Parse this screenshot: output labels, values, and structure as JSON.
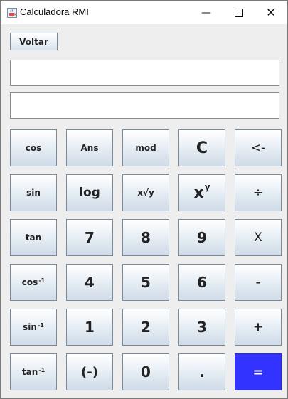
{
  "window": {
    "title": "Calculadora RMI",
    "minimize_glyph": "—",
    "close_glyph": "✕"
  },
  "toolbar": {
    "back_label": "Voltar"
  },
  "display": {
    "expression_value": "",
    "result_value": ""
  },
  "keys": [
    {
      "label": "cos"
    },
    {
      "label": "Ans"
    },
    {
      "label": "mod"
    },
    {
      "label": "C"
    },
    {
      "label": "<-"
    },
    {
      "label": "sin"
    },
    {
      "label": "log"
    },
    {
      "label": "x√y"
    },
    {
      "label": "x",
      "sup": "y"
    },
    {
      "label": "÷"
    },
    {
      "label": "tan"
    },
    {
      "label": "7"
    },
    {
      "label": "8"
    },
    {
      "label": "9"
    },
    {
      "label": "X"
    },
    {
      "label": "cos",
      "sup": "-1"
    },
    {
      "label": "4"
    },
    {
      "label": "5"
    },
    {
      "label": "6"
    },
    {
      "label": "-"
    },
    {
      "label": "sin",
      "sup": "-1"
    },
    {
      "label": "1"
    },
    {
      "label": "2"
    },
    {
      "label": "3"
    },
    {
      "label": "+"
    },
    {
      "label": "tan",
      "sup": "-1"
    },
    {
      "label": "(-)"
    },
    {
      "label": "0"
    },
    {
      "label": "."
    },
    {
      "label": "="
    }
  ],
  "colors": {
    "equals_button": "#3333ff",
    "window_background": "#eeeeee"
  },
  "icons": {
    "app": "java-cup-icon"
  }
}
